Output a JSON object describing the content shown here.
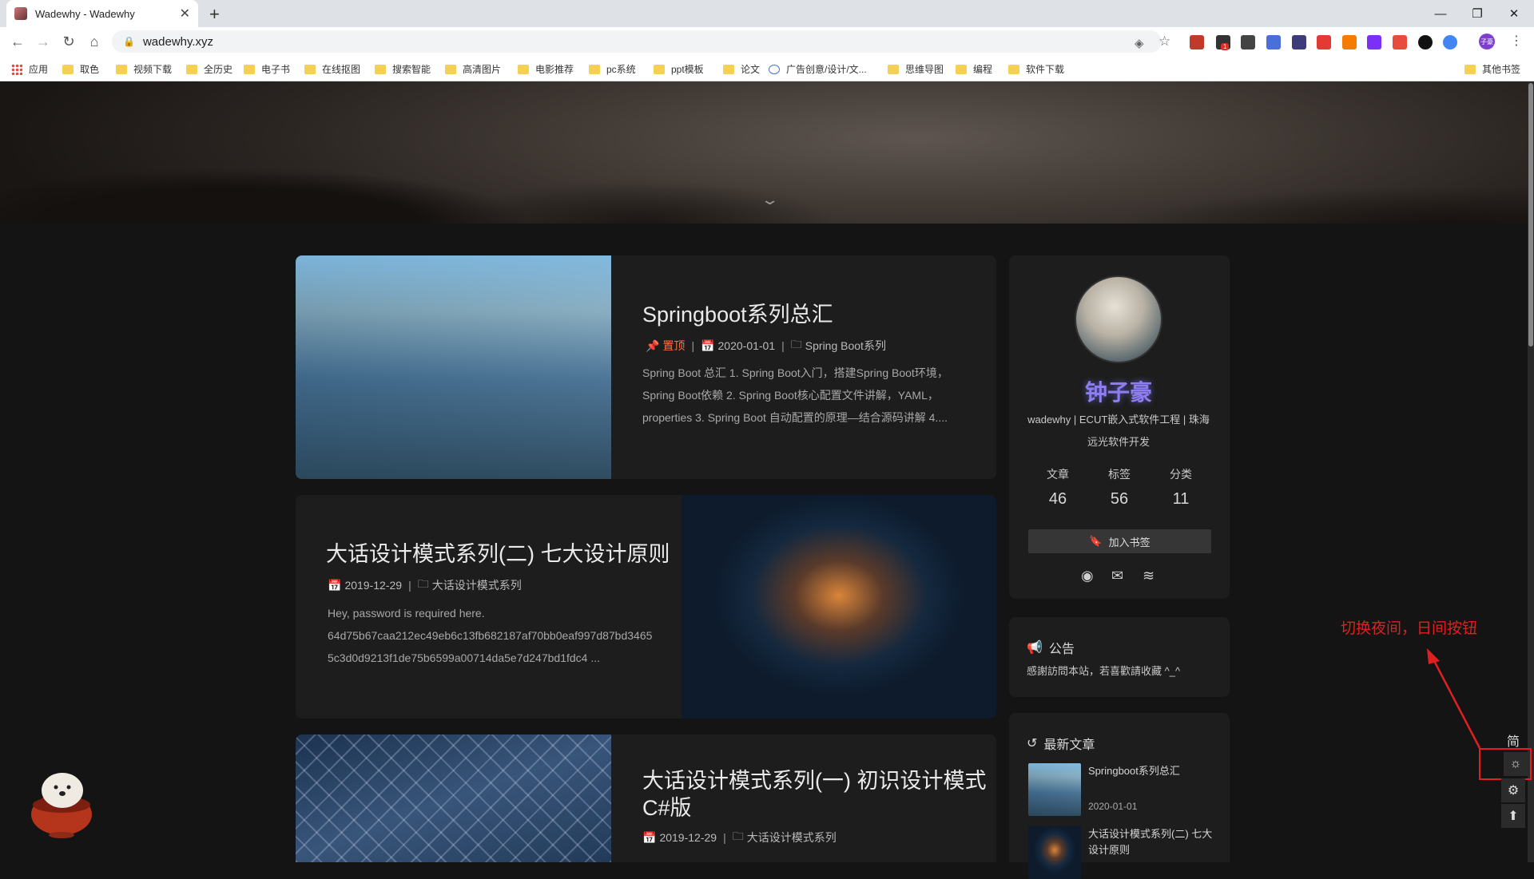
{
  "browser": {
    "tab_title": "Wadewhy - Wadewhy",
    "tab_close": "✕",
    "new_tab": "+",
    "url": "wadewhy.xyz",
    "window_controls": [
      "—",
      "❐",
      "✕"
    ],
    "extension_colors": [
      "#c0392b",
      "#333333",
      "#444444",
      "#4a6fd8",
      "#3c3c7a",
      "#e53935",
      "#f57c00",
      "#7b2ff7",
      "#e74c3c",
      "#111111",
      "#4285f4",
      "#7e57c2"
    ],
    "extension_badge": "1",
    "profile_initials": "子豪"
  },
  "bookmarks": {
    "apps": "应用",
    "items": [
      "取色",
      "视频下载",
      "全历史",
      "电子书",
      "在线抠图",
      "搜索智能",
      "高清图片",
      "电影推荐",
      "pc系统",
      "ppt模板",
      "论文",
      "广告创意/设计/文...",
      "思维导图",
      "编程",
      "软件下载"
    ],
    "other": "其他书签"
  },
  "posts": [
    {
      "title": "Springboot系列总汇",
      "pinned": "置顶",
      "date": "2020-01-01",
      "category": "Spring Boot系列",
      "excerpt": [
        "Spring Boot 总汇 1. Spring Boot入门，搭建Spring Boot环境，",
        "Spring Boot依赖 2. Spring Boot核心配置文件讲解，YAML，",
        "properties 3. Spring Boot 自动配置的原理—结合源码讲解 4...."
      ]
    },
    {
      "title": "大话设计模式系列(二) 七大设计原则",
      "date": "2019-12-29",
      "category": "大话设计模式系列",
      "excerpt": [
        "Hey, password is required here.",
        "64d75b67caa212ec49eb6c13fb682187af70bb0eaf997d87bd3465",
        "5c3d0d9213f1de75b6599a00714da5e7d247bd1fdc4 ..."
      ]
    },
    {
      "title": "大话设计模式系列(一) 初识设计模式",
      "title2": "C#版",
      "date": "2019-12-29",
      "category": "大话设计模式系列"
    }
  ],
  "sidebar": {
    "author": "钟子豪",
    "bio": "wadewhy | ECUT嵌入式软件工程 | 珠海远光软件开发",
    "stats": [
      {
        "label": "文章",
        "value": "46"
      },
      {
        "label": "标签",
        "value": "56"
      },
      {
        "label": "分类",
        "value": "11"
      }
    ],
    "bookmark_button": "加入书签",
    "notice_title": "公告",
    "notice_text": "感謝訪問本站，若喜歡請收藏 ^_^",
    "recent_title": "最新文章",
    "recent": [
      {
        "title": "Springboot系列总汇",
        "date": "2020-01-01"
      },
      {
        "title": "大话设计模式系列(二) 七大设计原则"
      }
    ]
  },
  "rightside": {
    "lang_button": "简",
    "annotation": "切换夜间，日间按钮"
  }
}
